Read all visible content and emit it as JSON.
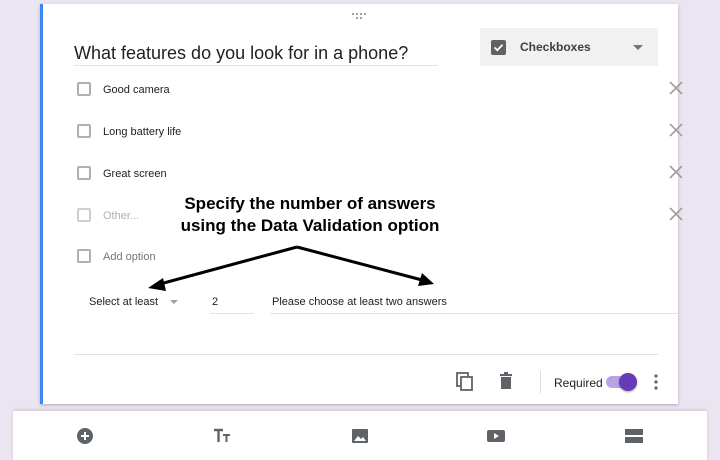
{
  "question": {
    "title": "What features do you look for in a phone?",
    "type_label": "Checkboxes"
  },
  "options": [
    {
      "label": "Good camera"
    },
    {
      "label": "Long battery life"
    },
    {
      "label": "Great screen"
    },
    {
      "label": "Other..."
    }
  ],
  "add_option_label": "Add option",
  "validation": {
    "rule_label": "Select at least",
    "number_value": "2",
    "error_text": "Please choose at least two answers"
  },
  "footer": {
    "required_label": "Required",
    "required_on": true
  },
  "annotation": {
    "line1": "Specify the number of answers",
    "line2": "using the Data Validation option"
  },
  "colors": {
    "accent": "#4285f4",
    "toggle": "#673ab7",
    "background": "#ebe5f1"
  },
  "icons": {
    "drag": "drag-handle-icon",
    "type": "checkbox-icon",
    "remove": "close-icon",
    "duplicate": "copy-icon",
    "delete": "trash-icon",
    "more": "more-vert-icon",
    "toolbar": [
      "add-circle-icon",
      "title-icon",
      "image-icon",
      "video-icon",
      "section-icon"
    ]
  }
}
